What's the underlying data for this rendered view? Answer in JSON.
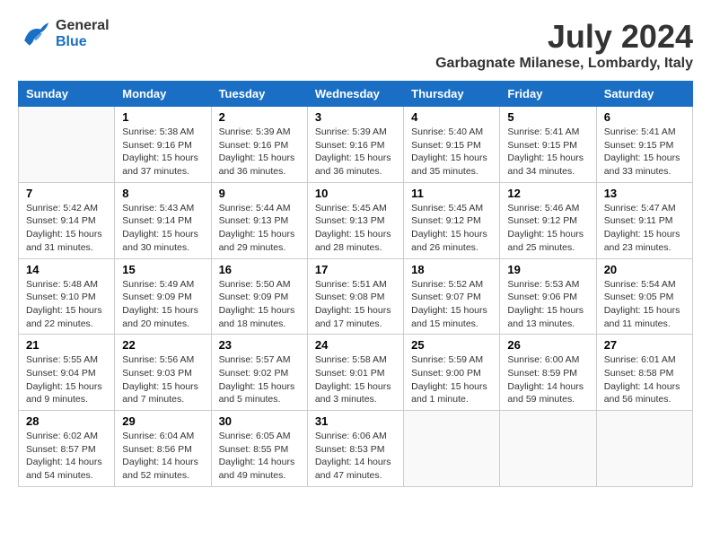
{
  "logo": {
    "line1": "General",
    "line2": "Blue"
  },
  "title": "July 2024",
  "subtitle": "Garbagnate Milanese, Lombardy, Italy",
  "days_of_week": [
    "Sunday",
    "Monday",
    "Tuesday",
    "Wednesday",
    "Thursday",
    "Friday",
    "Saturday"
  ],
  "weeks": [
    [
      {
        "day": "",
        "info": ""
      },
      {
        "day": "1",
        "info": "Sunrise: 5:38 AM\nSunset: 9:16 PM\nDaylight: 15 hours\nand 37 minutes."
      },
      {
        "day": "2",
        "info": "Sunrise: 5:39 AM\nSunset: 9:16 PM\nDaylight: 15 hours\nand 36 minutes."
      },
      {
        "day": "3",
        "info": "Sunrise: 5:39 AM\nSunset: 9:16 PM\nDaylight: 15 hours\nand 36 minutes."
      },
      {
        "day": "4",
        "info": "Sunrise: 5:40 AM\nSunset: 9:15 PM\nDaylight: 15 hours\nand 35 minutes."
      },
      {
        "day": "5",
        "info": "Sunrise: 5:41 AM\nSunset: 9:15 PM\nDaylight: 15 hours\nand 34 minutes."
      },
      {
        "day": "6",
        "info": "Sunrise: 5:41 AM\nSunset: 9:15 PM\nDaylight: 15 hours\nand 33 minutes."
      }
    ],
    [
      {
        "day": "7",
        "info": "Sunrise: 5:42 AM\nSunset: 9:14 PM\nDaylight: 15 hours\nand 31 minutes."
      },
      {
        "day": "8",
        "info": "Sunrise: 5:43 AM\nSunset: 9:14 PM\nDaylight: 15 hours\nand 30 minutes."
      },
      {
        "day": "9",
        "info": "Sunrise: 5:44 AM\nSunset: 9:13 PM\nDaylight: 15 hours\nand 29 minutes."
      },
      {
        "day": "10",
        "info": "Sunrise: 5:45 AM\nSunset: 9:13 PM\nDaylight: 15 hours\nand 28 minutes."
      },
      {
        "day": "11",
        "info": "Sunrise: 5:45 AM\nSunset: 9:12 PM\nDaylight: 15 hours\nand 26 minutes."
      },
      {
        "day": "12",
        "info": "Sunrise: 5:46 AM\nSunset: 9:12 PM\nDaylight: 15 hours\nand 25 minutes."
      },
      {
        "day": "13",
        "info": "Sunrise: 5:47 AM\nSunset: 9:11 PM\nDaylight: 15 hours\nand 23 minutes."
      }
    ],
    [
      {
        "day": "14",
        "info": "Sunrise: 5:48 AM\nSunset: 9:10 PM\nDaylight: 15 hours\nand 22 minutes."
      },
      {
        "day": "15",
        "info": "Sunrise: 5:49 AM\nSunset: 9:09 PM\nDaylight: 15 hours\nand 20 minutes."
      },
      {
        "day": "16",
        "info": "Sunrise: 5:50 AM\nSunset: 9:09 PM\nDaylight: 15 hours\nand 18 minutes."
      },
      {
        "day": "17",
        "info": "Sunrise: 5:51 AM\nSunset: 9:08 PM\nDaylight: 15 hours\nand 17 minutes."
      },
      {
        "day": "18",
        "info": "Sunrise: 5:52 AM\nSunset: 9:07 PM\nDaylight: 15 hours\nand 15 minutes."
      },
      {
        "day": "19",
        "info": "Sunrise: 5:53 AM\nSunset: 9:06 PM\nDaylight: 15 hours\nand 13 minutes."
      },
      {
        "day": "20",
        "info": "Sunrise: 5:54 AM\nSunset: 9:05 PM\nDaylight: 15 hours\nand 11 minutes."
      }
    ],
    [
      {
        "day": "21",
        "info": "Sunrise: 5:55 AM\nSunset: 9:04 PM\nDaylight: 15 hours\nand 9 minutes."
      },
      {
        "day": "22",
        "info": "Sunrise: 5:56 AM\nSunset: 9:03 PM\nDaylight: 15 hours\nand 7 minutes."
      },
      {
        "day": "23",
        "info": "Sunrise: 5:57 AM\nSunset: 9:02 PM\nDaylight: 15 hours\nand 5 minutes."
      },
      {
        "day": "24",
        "info": "Sunrise: 5:58 AM\nSunset: 9:01 PM\nDaylight: 15 hours\nand 3 minutes."
      },
      {
        "day": "25",
        "info": "Sunrise: 5:59 AM\nSunset: 9:00 PM\nDaylight: 15 hours\nand 1 minute."
      },
      {
        "day": "26",
        "info": "Sunrise: 6:00 AM\nSunset: 8:59 PM\nDaylight: 14 hours\nand 59 minutes."
      },
      {
        "day": "27",
        "info": "Sunrise: 6:01 AM\nSunset: 8:58 PM\nDaylight: 14 hours\nand 56 minutes."
      }
    ],
    [
      {
        "day": "28",
        "info": "Sunrise: 6:02 AM\nSunset: 8:57 PM\nDaylight: 14 hours\nand 54 minutes."
      },
      {
        "day": "29",
        "info": "Sunrise: 6:04 AM\nSunset: 8:56 PM\nDaylight: 14 hours\nand 52 minutes."
      },
      {
        "day": "30",
        "info": "Sunrise: 6:05 AM\nSunset: 8:55 PM\nDaylight: 14 hours\nand 49 minutes."
      },
      {
        "day": "31",
        "info": "Sunrise: 6:06 AM\nSunset: 8:53 PM\nDaylight: 14 hours\nand 47 minutes."
      },
      {
        "day": "",
        "info": ""
      },
      {
        "day": "",
        "info": ""
      },
      {
        "day": "",
        "info": ""
      }
    ]
  ]
}
